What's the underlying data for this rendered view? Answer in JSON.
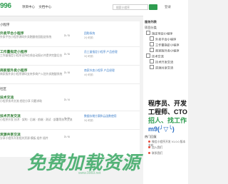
{
  "header": {
    "logo": "996",
    "nav": [
      "项目中心",
      "文档中心"
    ],
    "search_placeholder": "搜索小程序",
    "user": "登录"
  },
  "sections": [
    {
      "title": "小程序"
    },
    {
      "title": "社区"
    }
  ],
  "topics": [
    {
      "title": "外卖平台小程序",
      "desc": "外卖平台小程序源码外卖跑腿校园配送系统",
      "count": "3 / 5",
      "last": "团购系统",
      "time": "2小时前"
    },
    {
      "title": "工作量指定小程序",
      "desc": "工作量指定小程序支持在线自动报价并提供完整后台",
      "count": "3 / 6",
      "last": "员工量指定小程序 产品经理",
      "time": "3小时前"
    },
    {
      "title": "商家版外卖小程序",
      "desc": "商家版外卖小程序源码支持多商户入驻外卖跑腿系统",
      "count": "3 / 8",
      "last": "商家外卖小程序 产品经理",
      "time": "4小时前"
    },
    {
      "title": "技术交流",
      "desc": "小程序技术交流 经验分享 问题求助",
      "count": "3 / 4",
      "last": "",
      "time": ""
    },
    {
      "title": "技术开发交流",
      "desc": "小程序开发 技术 · 架构 · 后端 · 前端 · 测试 · 部署等技术交流",
      "count": "3 / 5",
      "last": "数据存储方案和云函数使用",
      "time": "3小时前"
    },
    {
      "title": "资源共享交流",
      "desc": "分享小程序开发相关资源 模板 组件 插件",
      "count": "3 / 6",
      "last": "",
      "time": ""
    }
  ],
  "sidebar": {
    "head1": "服务列表",
    "head2": "项目分类",
    "tree": [
      "指定项目小程序",
      "外卖平台小程序",
      "工作量指定小程序",
      "商家版外卖小程序",
      "技术交流",
      "技术开发交流",
      "资源共享交流"
    ],
    "ad_lines": [
      "程序员、开发",
      "工程师、CTO",
      "招人、找工作",
      "m9(╯▽╰)"
    ],
    "chat_head": "热门回复",
    "chats": [
      "微信小程序开发 V1.0.0 版本发布",
      "加入我们",
      "联系我们"
    ]
  },
  "watermark": "免费加载资源",
  "watermark_sub": "www.9969.net"
}
